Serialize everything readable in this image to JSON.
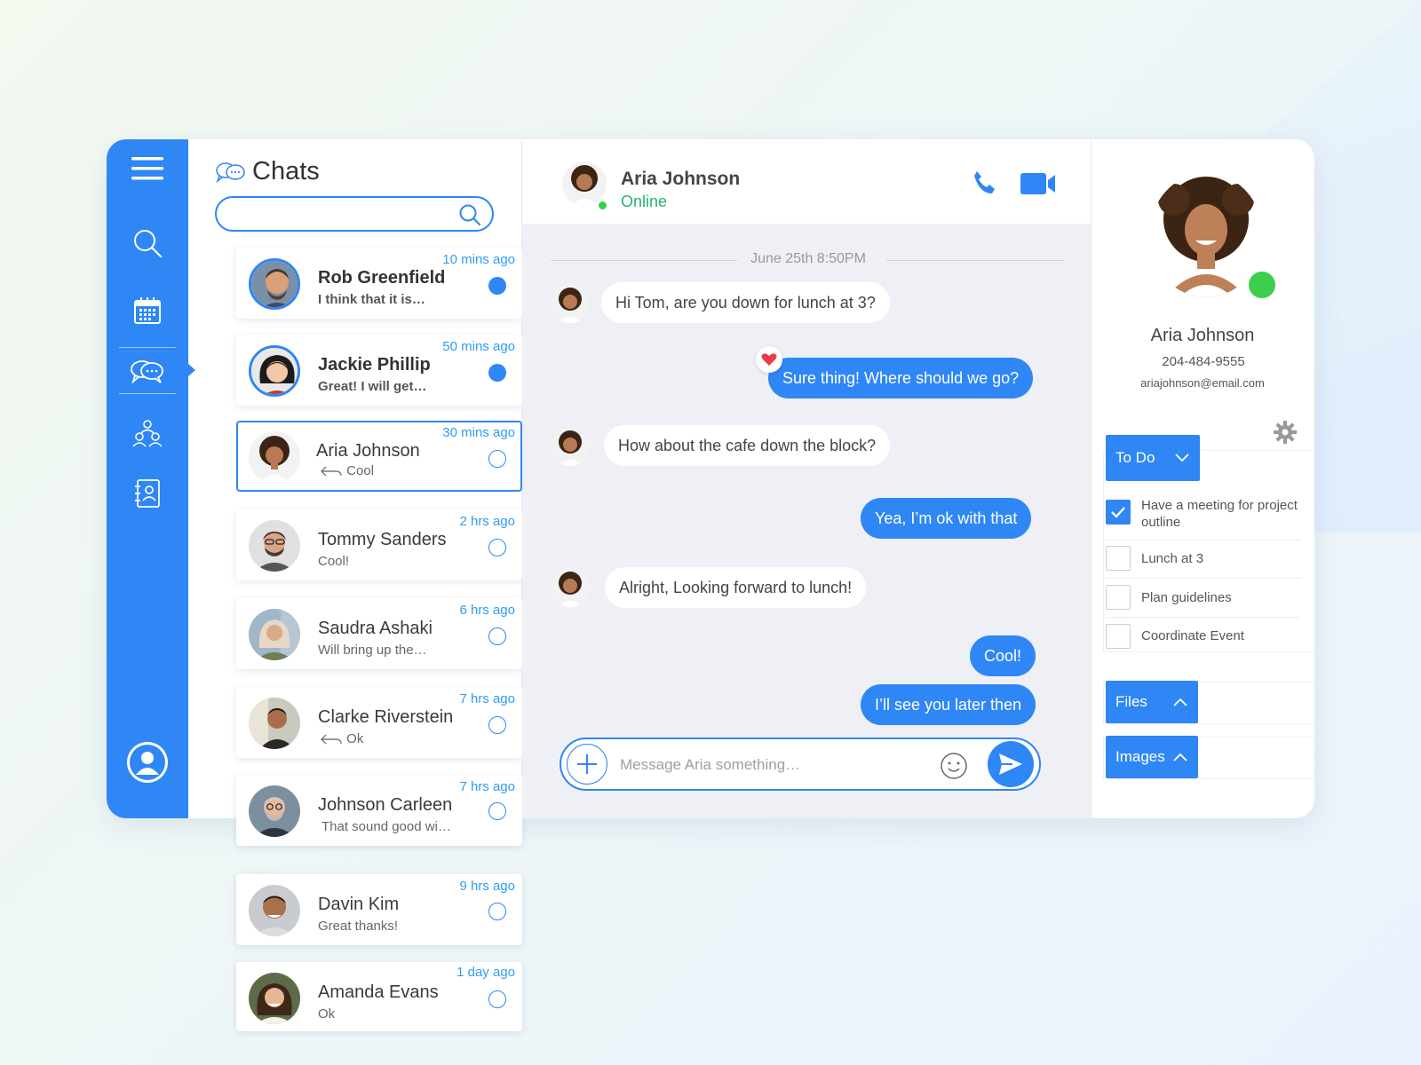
{
  "chats_panel": {
    "title": "Chats",
    "search_placeholder": "",
    "items": [
      {
        "name": "Rob Greenfield",
        "preview": "I think that it is…",
        "time": "10 mins ago",
        "unread": true
      },
      {
        "name": "Jackie Phillip",
        "preview": "Great! I will get…",
        "time": "50 mins ago",
        "unread": true
      },
      {
        "name": "Aria Johnson",
        "preview": "Cool",
        "time": "30 mins ago",
        "unread": false,
        "replied": true
      },
      {
        "name": "Tommy Sanders",
        "preview": "Cool!",
        "time": "2 hrs ago",
        "unread": false
      },
      {
        "name": "Saudra Ashaki",
        "preview": "Will bring up the…",
        "time": "6 hrs ago",
        "unread": false
      },
      {
        "name": "Clarke Riverstein",
        "preview": "Ok",
        "time": "7 hrs ago",
        "unread": false,
        "replied": true
      },
      {
        "name": "Johnson Carleen",
        "preview": "That sound good wi…",
        "time": "7 hrs ago",
        "unread": false
      },
      {
        "name": "Davin Kim",
        "preview": "Great thanks!",
        "time": "9 hrs ago",
        "unread": false
      },
      {
        "name": "Amanda Evans",
        "preview": "Ok",
        "time": "1 day ago",
        "unread": false
      }
    ]
  },
  "conversation": {
    "contact_name": "Aria Johnson",
    "status": "Online",
    "date_label": "June 25th  8:50PM",
    "messages": [
      {
        "from": "them",
        "text": "Hi Tom, are you down for lunch at 3?"
      },
      {
        "from": "me",
        "text": "Sure thing! Where should we go?",
        "reaction": "heart"
      },
      {
        "from": "them",
        "text": "How about the cafe down the block?"
      },
      {
        "from": "me",
        "text": "Yea, I’m ok with that"
      },
      {
        "from": "them",
        "text": "Alright, Looking forward to lunch!"
      },
      {
        "from": "me",
        "text": "Cool!"
      },
      {
        "from": "me",
        "text": "I’ll see you later then"
      }
    ],
    "composer_placeholder": "Message Aria something…"
  },
  "profile": {
    "name": "Aria Johnson",
    "phone": "204-484-9555",
    "email": "ariajohnson@email.com",
    "todo_label": "To Do",
    "todos": [
      {
        "text": "Have a meeting for project outline",
        "done": true
      },
      {
        "text": "Lunch at 3",
        "done": false
      },
      {
        "text": "Plan guidelines",
        "done": false
      },
      {
        "text": "Coordinate Event",
        "done": false
      }
    ],
    "files_label": "Files",
    "images_label": "Images"
  },
  "colors": {
    "accent": "#2f86f5",
    "online": "#3cce4d",
    "online_text": "#22b46a"
  }
}
